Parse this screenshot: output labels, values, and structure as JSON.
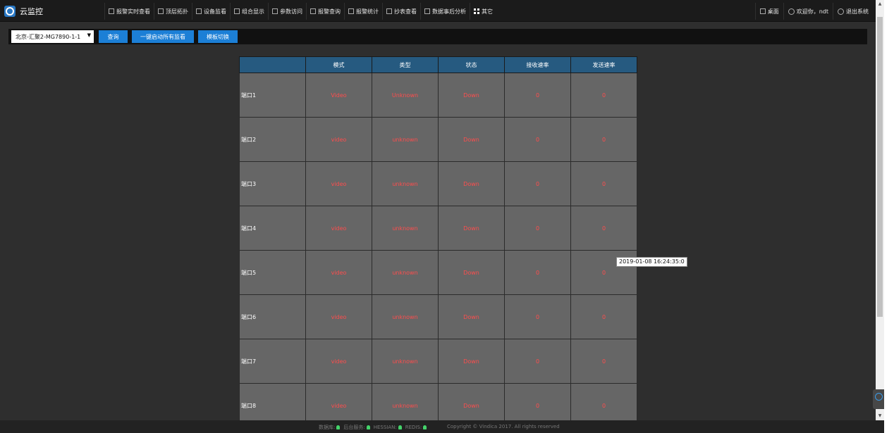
{
  "app": {
    "title": "云监控"
  },
  "nav": {
    "items": [
      "报警实时查看",
      "顶层拓扑",
      "设备监看",
      "组合显示",
      "参数访问",
      "报警查询",
      "报警统计",
      "抄表查看",
      "数据事后分析",
      "其它"
    ]
  },
  "right_nav": {
    "desktop": "桌面",
    "welcome": "欢迎你，ndt",
    "logout": "退出系统"
  },
  "toolbar": {
    "device_select": "北京-汇聚2-MG7890-1-1",
    "query_label": "查询",
    "start_all_label": "一键启动所有监看",
    "template_switch_label": "模板切换"
  },
  "table": {
    "headers": [
      "",
      "模式",
      "类型",
      "状态",
      "接收速率",
      "发送速率"
    ],
    "rows": [
      [
        "端口1",
        "Video",
        "Unknown",
        "Down",
        "0",
        "0"
      ],
      [
        "端口2",
        "video",
        "unknown",
        "Down",
        "0",
        "0"
      ],
      [
        "端口3",
        "video",
        "unknown",
        "Down",
        "0",
        "0"
      ],
      [
        "端口4",
        "video",
        "unknown",
        "Down",
        "0",
        "0"
      ],
      [
        "端口5",
        "video",
        "unknown",
        "Down",
        "0",
        "0"
      ],
      [
        "端口6",
        "video",
        "unknown",
        "Down",
        "0",
        "0"
      ],
      [
        "端口7",
        "video",
        "unknown",
        "Down",
        "0",
        "0"
      ],
      [
        "端口8",
        "video",
        "unknown",
        "Down",
        "0",
        "0"
      ]
    ]
  },
  "tooltip": "2019-01-08 16:24:35:0",
  "footer": {
    "db_label": "数据库:",
    "backend_label": "后台服务:",
    "hessian_label": "HESSIAN:",
    "redis_label": "REDIS:",
    "copyright": "Copyright © Vindica 2017. All rights reserved"
  },
  "colors": {
    "accent": "#1c7fd6",
    "header": "#265a80",
    "alert": "#ff4d4d",
    "status_ok": "#44d36a"
  }
}
